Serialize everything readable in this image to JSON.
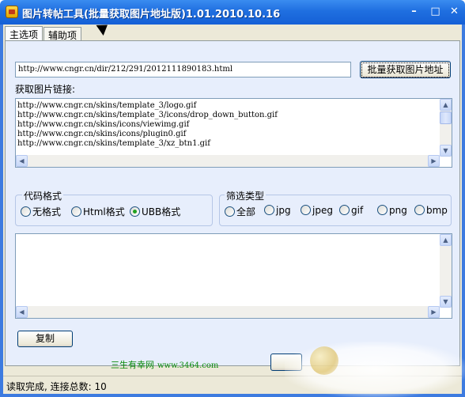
{
  "window": {
    "title": "图片转帖工具(批量获取图片地址版)1.01.2010.10.16",
    "controls": {
      "minimize": "–",
      "maximize": "□",
      "close": "✕"
    }
  },
  "tabs": [
    {
      "label": "主选项"
    },
    {
      "label": "辅助项"
    }
  ],
  "url_input": {
    "value": "http://www.cngr.cn/dir/212/291/2012111890183.html"
  },
  "fetch_button": {
    "label": "批量获取图片地址"
  },
  "links_label": "获取图片链接:",
  "links": [
    "http://www.cngr.cn/skins/template_3/logo.gif",
    "http://www.cngr.cn/skins/template_3/icons/drop_down_button.gif",
    "http://www.cngr.cn/skins/icons/viewimg.gif",
    "http://www.cngr.cn/skins/icons/plugin0.gif",
    "http://www.cngr.cn/skins/template_3/xz_btn1.gif"
  ],
  "code_format": {
    "legend": "代码格式",
    "options": [
      {
        "label": "无格式",
        "selected": false
      },
      {
        "label": "Html格式",
        "selected": false
      },
      {
        "label": "UBB格式",
        "selected": true
      }
    ]
  },
  "filter_type": {
    "legend": "筛选类型",
    "options": [
      {
        "label": "全部",
        "selected": false
      },
      {
        "label": "jpg",
        "selected": false
      },
      {
        "label": "jpeg",
        "selected": false
      },
      {
        "label": "gif",
        "selected": false
      },
      {
        "label": "png",
        "selected": false
      },
      {
        "label": "bmp",
        "selected": false
      }
    ]
  },
  "copy_button": {
    "label": "复制"
  },
  "site": {
    "name": "三生有幸网",
    "url": "www.3464.com"
  },
  "status": "读取完成, 连接总数: 10",
  "scroll": {
    "up": "▲",
    "down": "▼",
    "left": "◀",
    "right": "▶"
  },
  "colors": {
    "titlebar": "#1f6fe0",
    "panel": "#e7eefc",
    "site_text": "#0a8a0a",
    "radio_selected": "#21a121"
  }
}
